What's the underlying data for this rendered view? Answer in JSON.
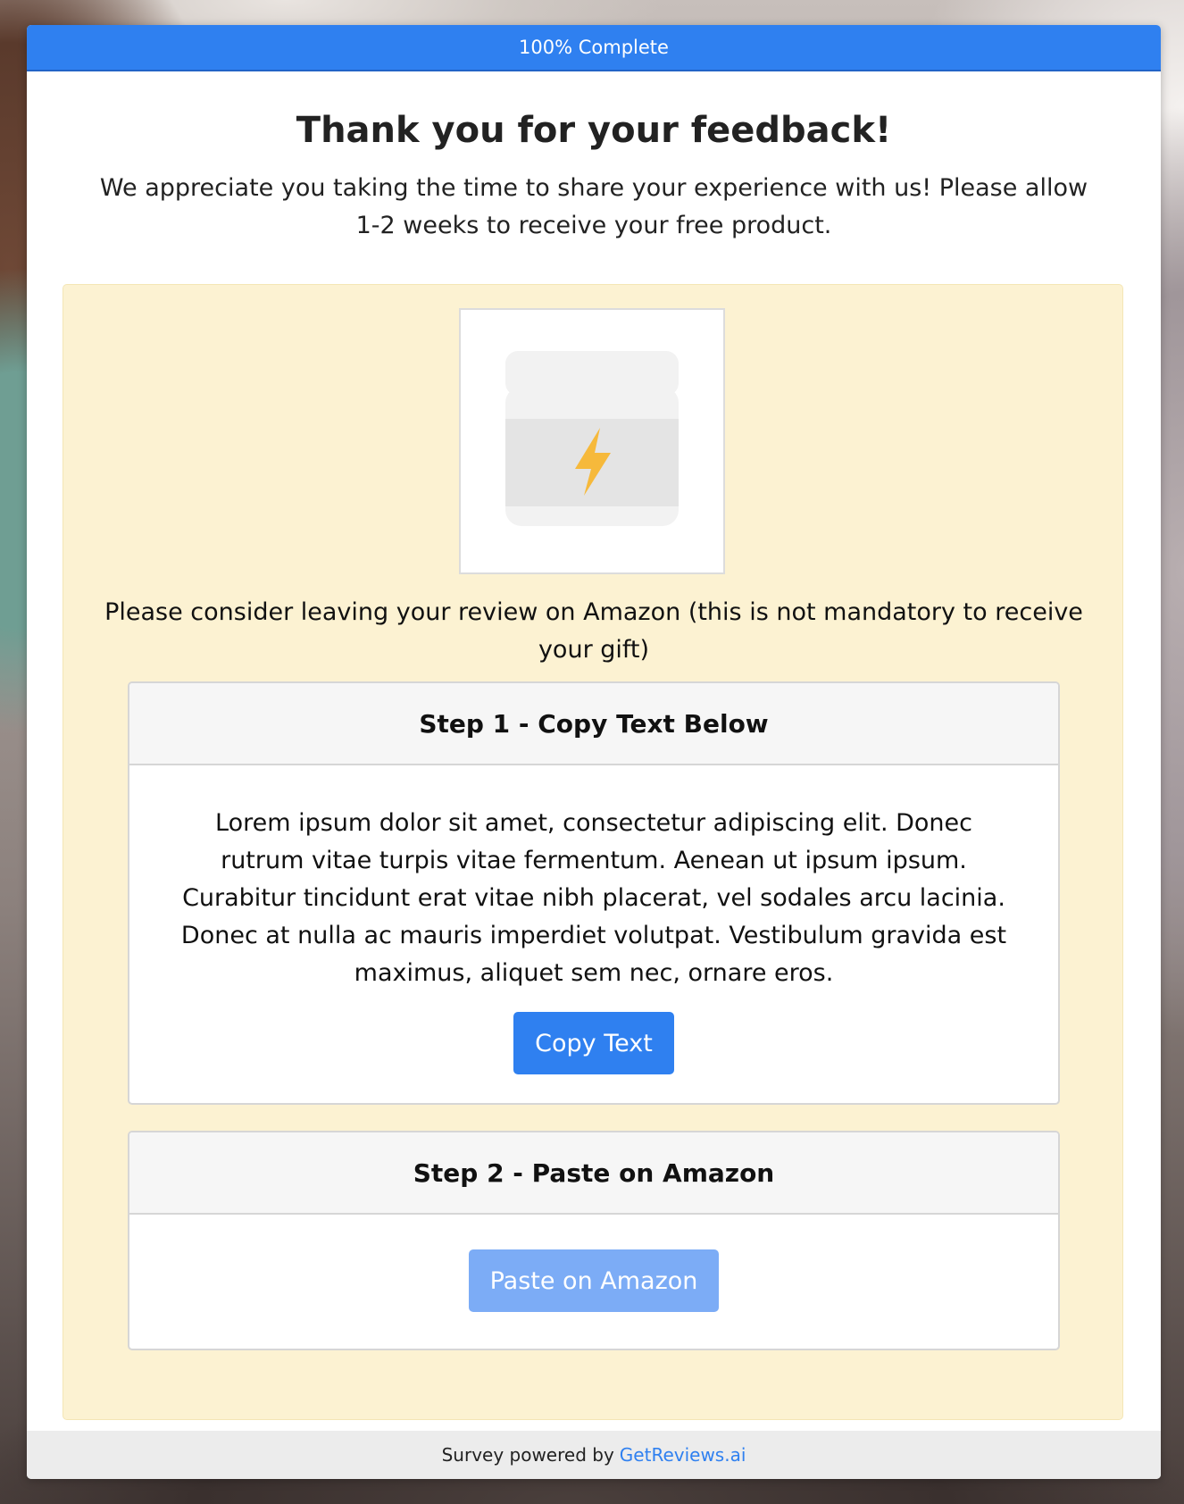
{
  "progress": {
    "label": "100% Complete",
    "percent": 100
  },
  "header": {
    "title": "Thank you for your feedback!",
    "lead": "We appreciate you taking the time to share your experience with us! Please allow 1-2 weeks to receive your free product."
  },
  "offer": {
    "product_icon": "supplement-jar-lightning-icon",
    "consider_text": "Please consider leaving your review on Amazon (this is not mandatory to receive your gift)"
  },
  "step1": {
    "heading": "Step 1 - Copy Text Below",
    "review_text": "Lorem ipsum dolor sit amet, consectetur adipiscing elit. Donec rutrum vitae turpis vitae fermentum. Aenean ut ipsum ipsum. Curabitur tincidunt erat vitae nibh placerat, vel sodales arcu lacinia. Donec at nulla ac mauris imperdiet volutpat. Vestibulum gravida est maximus, aliquet sem nec, ornare eros.",
    "button_label": "Copy Text"
  },
  "step2": {
    "heading": "Step 2 - Paste on Amazon",
    "button_label": "Paste on Amazon"
  },
  "footer": {
    "prefix": "Survey powered by",
    "link_text": "GetReviews.ai"
  },
  "colors": {
    "accent": "#2f80f0",
    "accent_disabled": "#7cacf6",
    "offer_background": "#fcf2d2",
    "lightning": "#f6b93b"
  }
}
